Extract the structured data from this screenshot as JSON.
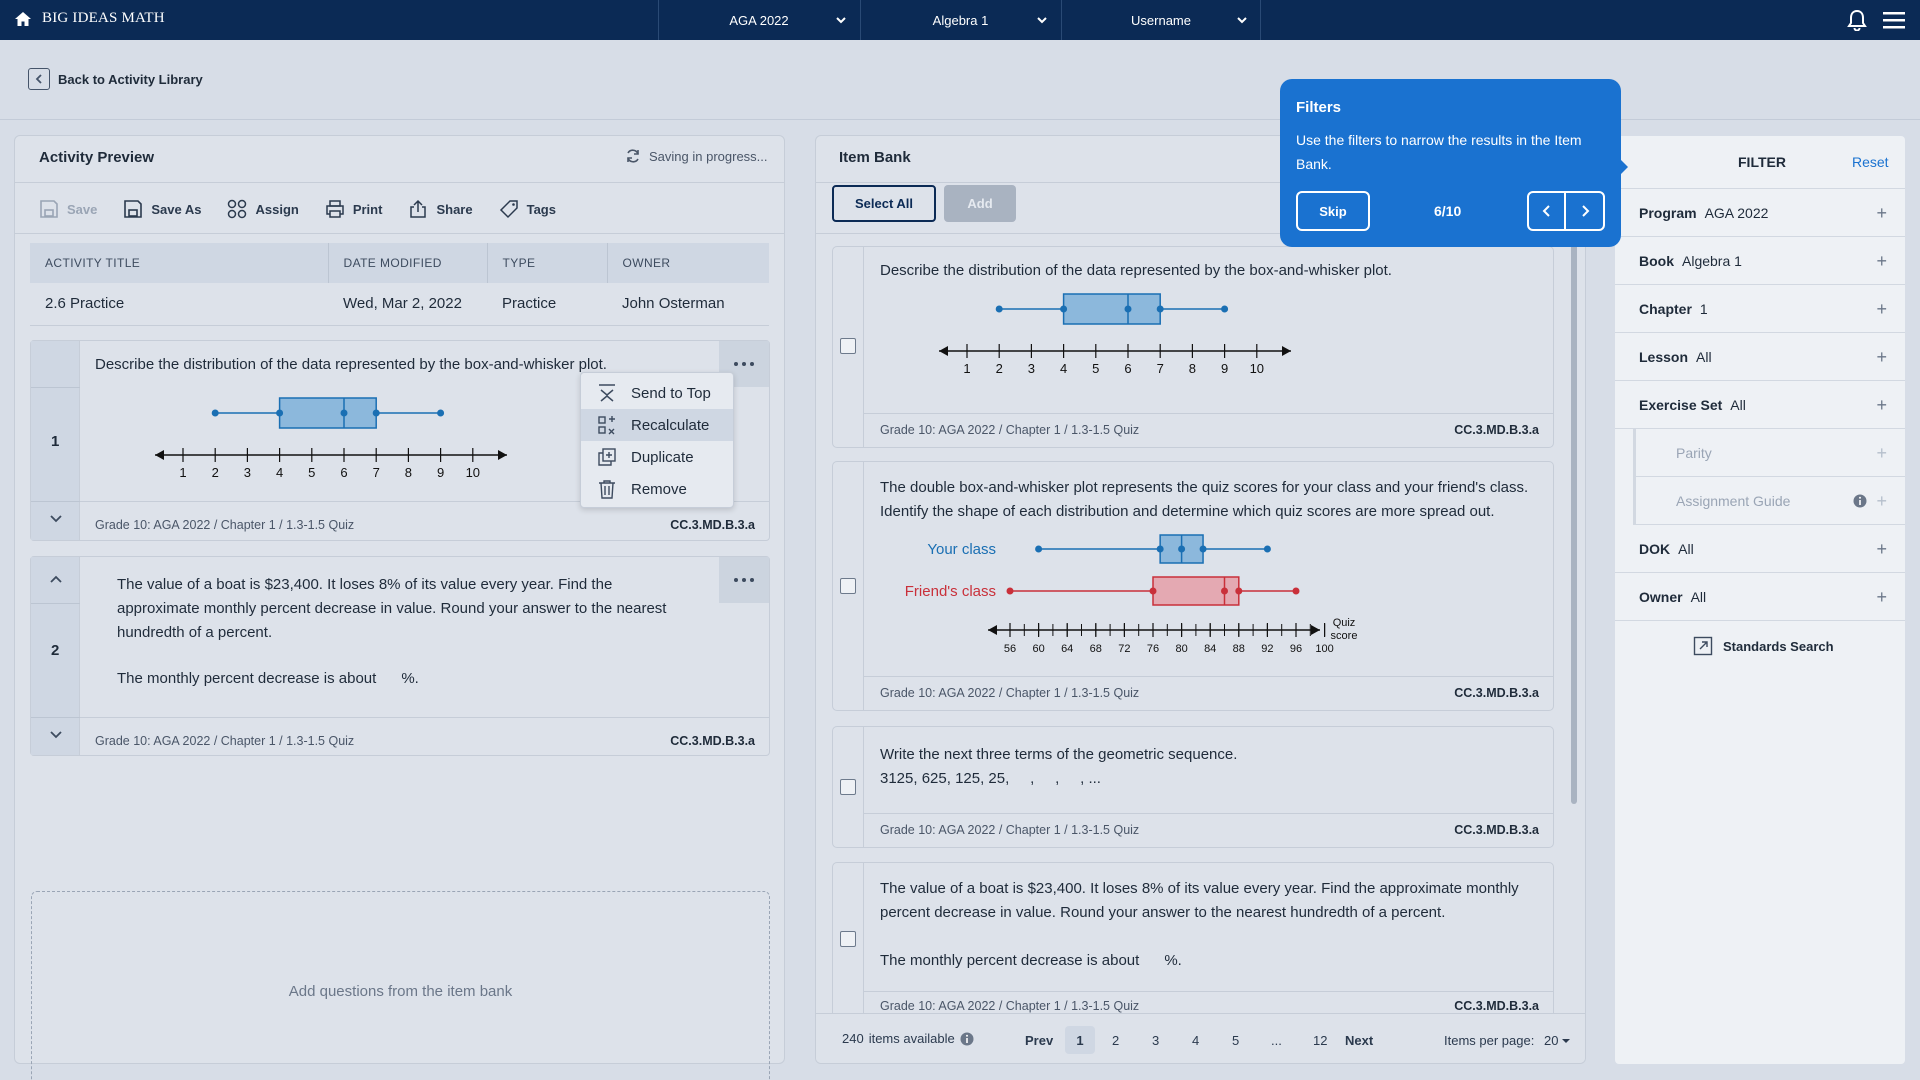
{
  "topbar": {
    "brand": "BIG IDEAS MATH",
    "program": "AGA 2022",
    "course": "Algebra 1",
    "user": "Username"
  },
  "back_label": "Back to Activity Library",
  "preview": {
    "title": "Activity Preview",
    "saving": "Saving in progress...",
    "toolbar": {
      "save": "Save",
      "save_as": "Save As",
      "assign": "Assign",
      "print": "Print",
      "share": "Share",
      "tags": "Tags"
    },
    "table": {
      "headers": [
        "ACTIVITY TITLE",
        "DATE MODIFIED",
        "TYPE",
        "OWNER"
      ],
      "row": [
        "2.6 Practice",
        "Wed, Mar 2, 2022",
        "Practice",
        "John Osterman"
      ]
    },
    "questions": [
      {
        "num": "1",
        "text": "Describe the distribution of the data represented by the box-and-whisker plot.",
        "source": "Grade 10: AGA 2022 / Chapter 1 / 1.3-1.5 Quiz",
        "standard": "CC.3.MD.B.3.a"
      },
      {
        "num": "2",
        "text": "The value of a boat is $23,400. It loses 8% of its value every year. Find the approximate monthly percent decrease in value. Round your answer to the nearest hundredth of a percent.",
        "answer": "The monthly percent decrease is about      %.",
        "source": "Grade 10: AGA 2022 / Chapter 1 / 1.3-1.5 Quiz",
        "standard": "CC.3.MD.B.3.a"
      }
    ],
    "context_menu": [
      "Send to Top",
      "Recalculate",
      "Duplicate",
      "Remove"
    ],
    "dropzone": "Add questions from the item bank"
  },
  "itembank": {
    "title": "Item Bank",
    "select_all": "Select All",
    "add": "Add",
    "items": [
      {
        "text": "Describe the distribution of the data represented by the box-and-whisker plot.",
        "source": "Grade 10: AGA 2022 / Chapter 1 / 1.3-1.5 Quiz",
        "standard": "CC.3.MD.B.3.a"
      },
      {
        "text": "The double box-and-whisker plot represents the quiz scores for your class and your friend's class. Identify the shape of each distribution and determine which quiz scores are more spread out.",
        "series1": "Your class",
        "series2": "Friend's class",
        "axis_label_1": "Quiz",
        "axis_label_2": "score",
        "source": "Grade 10: AGA 2022 / Chapter 1 / 1.3-1.5 Quiz",
        "standard": "CC.3.MD.B.3.a"
      },
      {
        "text": "Write the next three terms of the geometric sequence.",
        "sequence": "3125, 625, 125, 25,     ,     ,     , ...",
        "source": "Grade 10: AGA 2022 / Chapter 1 / 1.3-1.5 Quiz",
        "standard": "CC.3.MD.B.3.a"
      },
      {
        "text": "The value of a boat is $23,400. It loses 8% of its value every year. Find the approximate monthly percent decrease in value. Round your answer to the nearest hundredth of a percent.",
        "answer": "The monthly percent decrease is about      %.",
        "source": "Grade 10: AGA 2022 / Chapter 1 / 1.3-1.5 Quiz",
        "standard": "CC.3.MD.B.3.a"
      }
    ],
    "footer": {
      "count": "240",
      "count_label": "items available",
      "prev": "Prev",
      "pages": [
        "1",
        "2",
        "3",
        "4",
        "5",
        "...",
        "12"
      ],
      "next": "Next",
      "per_page_label": "Items per page:",
      "per_page": "20"
    }
  },
  "tooltip": {
    "title": "Filters",
    "body": "Use the filters to narrow the results in the Item Bank.",
    "skip": "Skip",
    "progress": "6/10"
  },
  "filter": {
    "title": "FILTER",
    "reset": "Reset",
    "rows": [
      {
        "label": "Program",
        "value": "AGA 2022"
      },
      {
        "label": "Book",
        "value": "Algebra 1"
      },
      {
        "label": "Chapter",
        "value": "1"
      },
      {
        "label": "Lesson",
        "value": "All"
      },
      {
        "label": "Exercise Set",
        "value": "All"
      }
    ],
    "subrows": [
      "Parity",
      "Assignment Guide"
    ],
    "rows2": [
      {
        "label": "DOK",
        "value": "All"
      },
      {
        "label": "Owner",
        "value": "All"
      }
    ],
    "standards": "Standards Search"
  },
  "plots": {
    "single": {
      "min": 2,
      "q1": 4,
      "median": 6,
      "q3": 7,
      "max": 9,
      "axis": [
        1,
        2,
        3,
        4,
        5,
        6,
        7,
        8,
        9,
        10
      ]
    },
    "your_class": {
      "min": 60,
      "q1": 77,
      "median": 80,
      "q3": 83,
      "max": 92
    },
    "friends_class": {
      "min": 56,
      "q1": 76,
      "median": 86,
      "q3": 88,
      "max": 96
    },
    "double_axis": [
      56,
      60,
      64,
      68,
      72,
      76,
      80,
      84,
      88,
      92,
      96,
      100
    ]
  }
}
